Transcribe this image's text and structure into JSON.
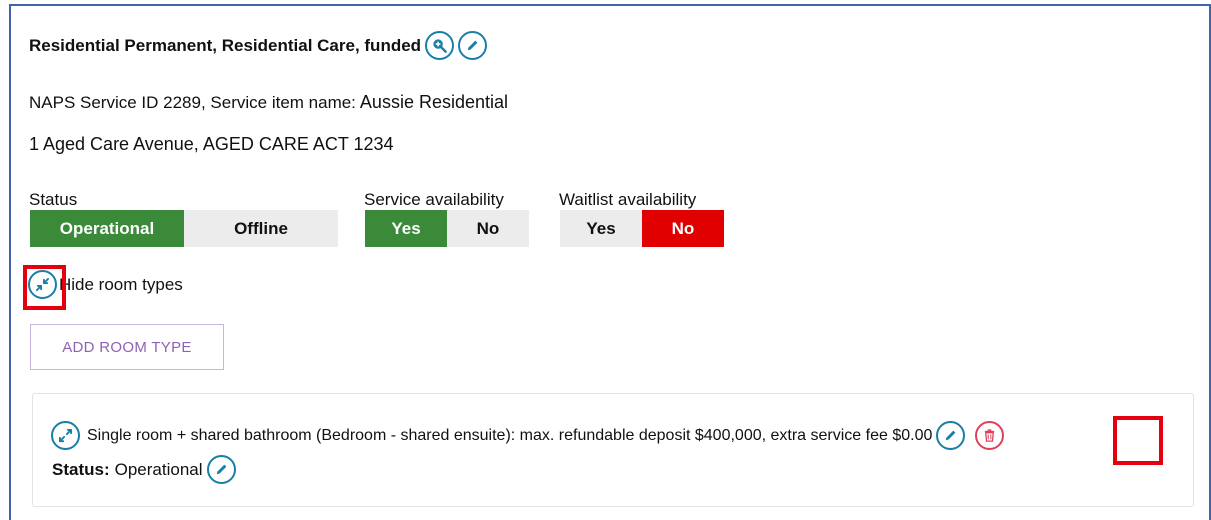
{
  "service": {
    "title": "Residential Permanent, Residential Care, funded",
    "naps_line": "NAPS Service ID 2289, Service item name:",
    "service_item_name": "Aussie Residential",
    "address": "1 Aged Care Avenue, AGED CARE ACT 1234"
  },
  "status": {
    "label": "Status",
    "options": [
      "Operational",
      "Offline"
    ],
    "selected": "Operational"
  },
  "service_availability": {
    "label": "Service availability",
    "options": [
      "Yes",
      "No"
    ],
    "selected": "Yes"
  },
  "waitlist_availability": {
    "label": "Waitlist availability",
    "options": [
      "Yes",
      "No"
    ],
    "selected": "No"
  },
  "room_types_toggle": {
    "label": "Hide room types"
  },
  "add_room_type": {
    "label": "ADD ROOM TYPE"
  },
  "room": {
    "description": "Single room + shared bathroom (Bedroom - shared ensuite): max. refundable deposit $400,000, extra service fee $0.00",
    "status_label": "Status:",
    "status_value": "Operational"
  },
  "icons": [
    "zoom-in-icon",
    "pencil-icon",
    "collapse-icon",
    "expand-icon",
    "trash-icon"
  ],
  "colors": {
    "accent": "#1a7fa6",
    "selected_green": "#3a8a3a",
    "selected_red": "#e00000",
    "unselected": "#ececec",
    "annotation_red": "#e4000f",
    "button_purple": "#8e62b8",
    "card_border": "#3f64a8"
  }
}
